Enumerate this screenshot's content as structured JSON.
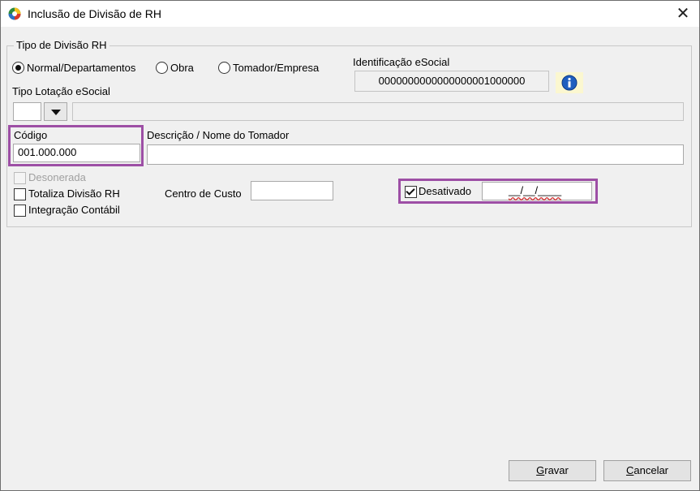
{
  "window": {
    "title": "Inclusão de Divisão de RH"
  },
  "group": {
    "legend": "Tipo de Divisão RH",
    "radios": [
      {
        "label": "Normal/Departamentos",
        "selected": true
      },
      {
        "label": "Obra",
        "selected": false
      },
      {
        "label": "Tomador/Empresa",
        "selected": false
      }
    ]
  },
  "esocial": {
    "label": "Identificação eSocial",
    "value": "0000000000000000001000000"
  },
  "lotacao": {
    "label": "Tipo Lotação eSocial",
    "code": "",
    "description": ""
  },
  "codigo": {
    "label": "Código",
    "value": "001.000.000"
  },
  "descricao": {
    "label": "Descrição / Nome do Tomador",
    "value": ""
  },
  "checks": {
    "desonerada": {
      "label": "Desonerada",
      "checked": false,
      "disabled": true
    },
    "totaliza": {
      "label": "Totaliza Divisão RH",
      "checked": false
    },
    "integracao": {
      "label": "Integração Contábil",
      "checked": false
    }
  },
  "centro": {
    "label": "Centro de Custo",
    "value": ""
  },
  "desativado": {
    "label": "Desativado",
    "checked": true,
    "date_mask": "__/__/____"
  },
  "buttons": {
    "gravar": {
      "prefix": "",
      "accel": "G",
      "rest": "ravar"
    },
    "cancelar": {
      "prefix": "",
      "accel": "C",
      "rest": "ancelar"
    }
  },
  "colors": {
    "highlight": "#9d4fa5",
    "info": "#1f5fbf"
  }
}
